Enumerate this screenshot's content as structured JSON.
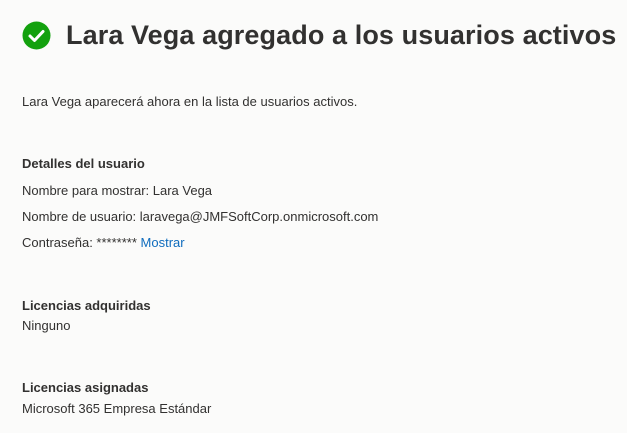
{
  "header": {
    "icon": "checkmark-circle-icon",
    "icon_color": "#13a10e",
    "title": "Lara Vega agregado a los usuarios activos"
  },
  "intro": "Lara Vega aparecerá ahora en la lista de usuarios activos.",
  "user_details": {
    "heading": "Detalles del usuario",
    "display_name": "Nombre para mostrar: Lara Vega",
    "username": "Nombre de usuario: laravega@JMFSoftCorp.onmicrosoft.com",
    "password_label": "Contraseña: ********",
    "show_link": "Mostrar"
  },
  "purchased_licenses": {
    "heading": "Licencias adquiridas",
    "value": "Ninguno"
  },
  "assigned_licenses": {
    "heading": "Licencias asignadas",
    "value": "Microsoft 365 Empresa Estándar"
  },
  "colors": {
    "link": "#0f6cbd",
    "text": "#323130",
    "background": "#fbfbfa"
  }
}
